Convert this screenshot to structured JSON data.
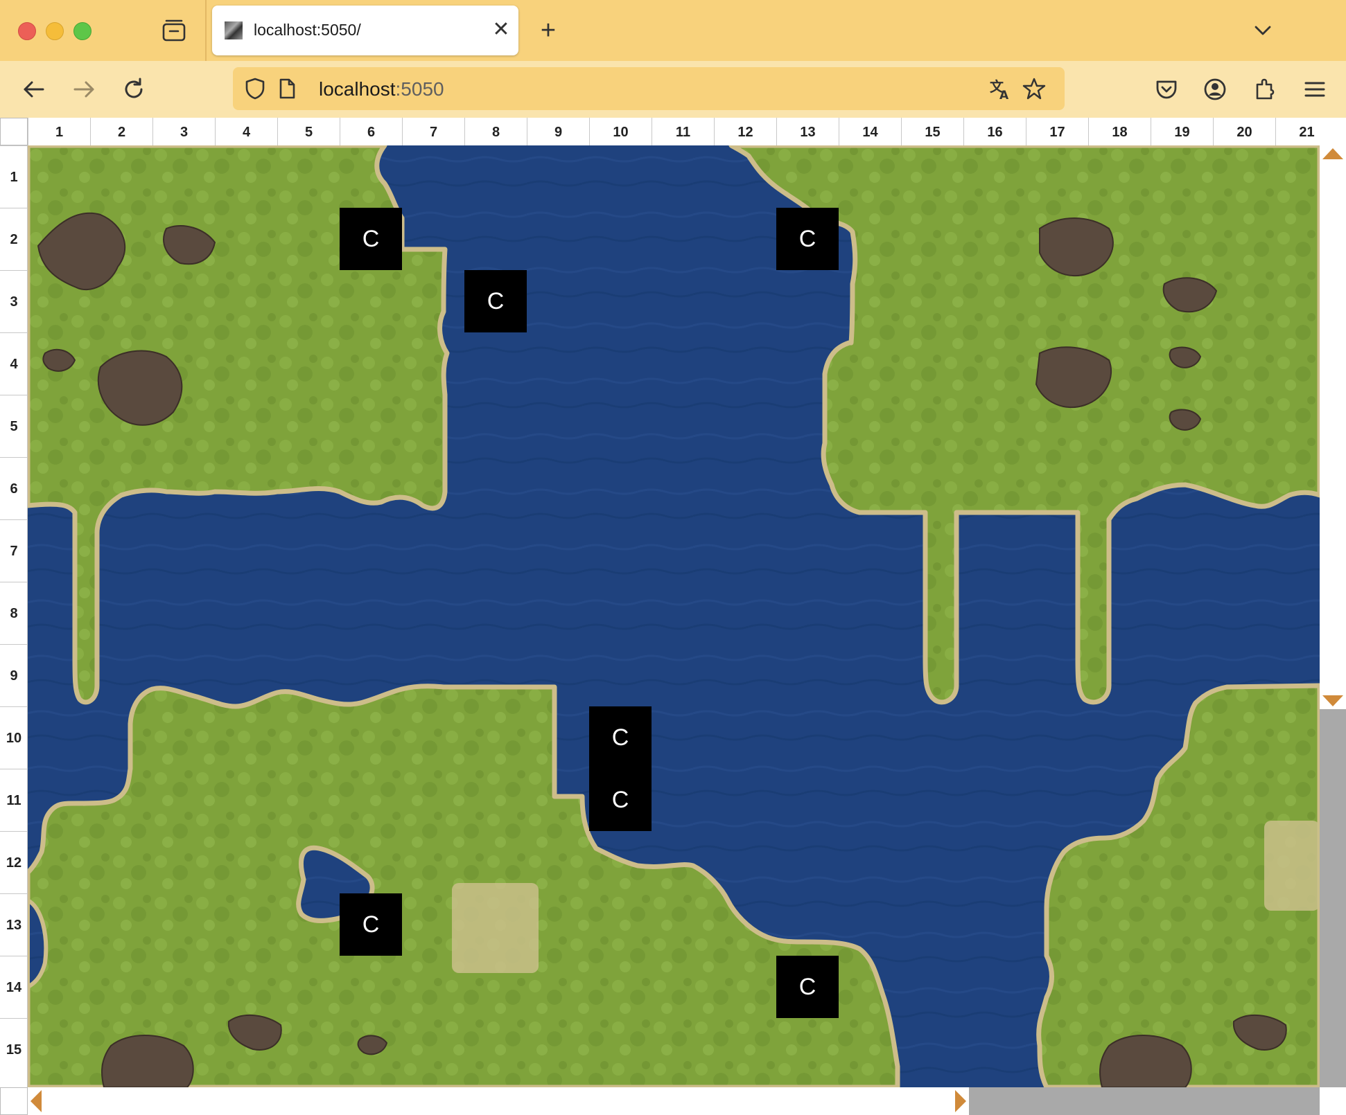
{
  "browser": {
    "tab_title": "localhost:5050/",
    "url_host": "localhost",
    "url_port": ":5050",
    "icons": {
      "close_window": "red-traffic-light",
      "minimize": "yellow-traffic-light",
      "maximize": "green-traffic-light",
      "tab_overview": "tab-overview-icon",
      "tab_close": "close-icon",
      "new_tab": "plus-icon",
      "tab_list": "chevron-down-icon",
      "back": "back-arrow-icon",
      "forward": "forward-arrow-icon",
      "reload": "reload-icon",
      "shield": "shield-icon",
      "page": "page-icon",
      "translate": "translate-icon",
      "bookmark": "star-icon",
      "pocket": "pocket-icon",
      "account": "account-icon",
      "extensions": "extensions-icon",
      "menu": "hamburger-menu-icon"
    },
    "tab_close_glyph": "✕",
    "new_tab_glyph": "+"
  },
  "grid": {
    "column_labels": [
      "1",
      "2",
      "3",
      "4",
      "5",
      "6",
      "7",
      "8",
      "9",
      "10",
      "11",
      "12",
      "13",
      "14",
      "15",
      "16",
      "17",
      "18",
      "19",
      "20",
      "21"
    ],
    "row_labels": [
      "1",
      "2",
      "3",
      "4",
      "5",
      "6",
      "7",
      "8",
      "9",
      "10",
      "11",
      "12",
      "13",
      "14",
      "15"
    ]
  },
  "map": {
    "terrain": "grass with water channels, rocky outcrops and sandy patches",
    "units": [
      {
        "label": "C",
        "col": 6,
        "row": 2
      },
      {
        "label": "C",
        "col": 13,
        "row": 2
      },
      {
        "label": "C",
        "col": 8,
        "row": 3
      },
      {
        "label": "C",
        "col": 10,
        "row": 10
      },
      {
        "label": "C",
        "col": 10,
        "row": 11
      },
      {
        "label": "C",
        "col": 6,
        "row": 13
      },
      {
        "label": "C",
        "col": 13,
        "row": 14
      }
    ]
  },
  "colors": {
    "chrome_tabbar": "#f8d27c",
    "chrome_navbar": "#fae4ad",
    "grass": "#7fa33b",
    "water": "#1f427e",
    "shore": "#cdbd8a",
    "unit_bg": "#000000",
    "unit_text": "#ffffff",
    "scroll_arrow": "#d08a3a",
    "scroll_thumb": "#a9a9a9"
  }
}
